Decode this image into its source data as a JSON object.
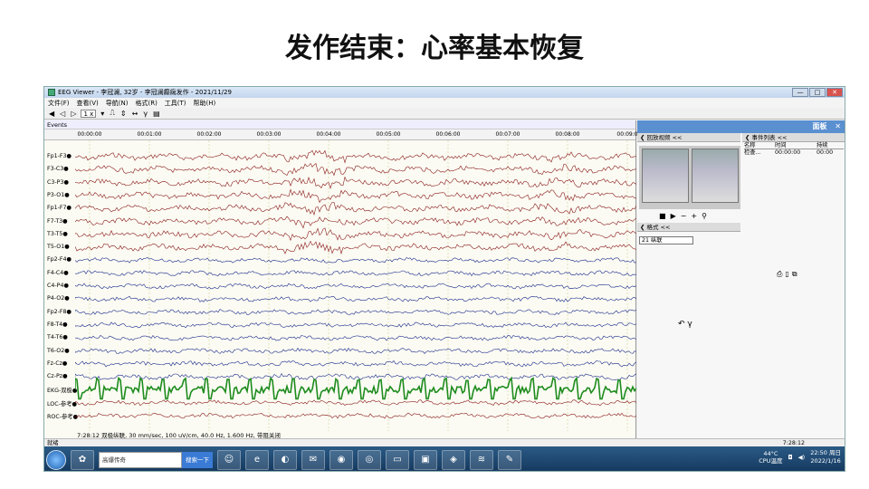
{
  "slide": {
    "title": "发作结束：心率基本恢复"
  },
  "window": {
    "title": "EEG Viewer - 李冠澜, 32岁 - 李冠澜癫痫发作 - 2021/11/29",
    "controls": [
      "—",
      "□",
      "✕"
    ]
  },
  "menu": [
    "文件(F)",
    "查看(V)",
    "导航(N)",
    "格式(R)",
    "工具(T)",
    "帮助(H)"
  ],
  "toolbar": {
    "speed_value": "1 x"
  },
  "eeg": {
    "events_label": "Events",
    "time_labels": [
      "00:00:00",
      "00:01:00",
      "00:02:00",
      "00:03:00",
      "00:04:00",
      "00:05:00",
      "00:06:00",
      "00:07:00",
      "00:08:00",
      "00:09:0"
    ],
    "channels": [
      "Fp1-F3",
      "F3-C3",
      "C3-P3",
      "P3-O1",
      "Fp1-F7",
      "F7-T3",
      "T3-T5",
      "T5-O1",
      "Fp2-F4",
      "F4-C4",
      "C4-P4",
      "P4-O2",
      "Fp2-F8",
      "F8-T4",
      "T4-T6",
      "T6-O2",
      "Fz-Cz",
      "Cz-Pz",
      "EKG-双极",
      "LOC-参考",
      "ROC-参考"
    ],
    "info_text": "7:28:12 双极纵联, 30 mm/sec, 100 uV/cm, 40.0 Hz, 1.600 Hz, 带阻关闭",
    "colors": {
      "red_channels": "#8b1a1a",
      "blue_channels": "#1a2a8b",
      "ekg": "#1e8c1e"
    }
  },
  "panel": {
    "title": "面板",
    "close": "✕",
    "video_section": "回放视频 <<",
    "event_section": "事件列表 <<",
    "format_section": "格式 <<",
    "format_value": "21  纵联",
    "event_headers": [
      "名称",
      "时间",
      "持续"
    ],
    "event_rows": [
      [
        "检查...",
        "00:00:00",
        "00:00"
      ]
    ]
  },
  "status": {
    "left": "就绪",
    "right": "7:28:12"
  },
  "taskbar": {
    "search_text": "高爆传奇",
    "search_button": "搜索一下",
    "temp": "44°C",
    "temp_label": "CPU温度",
    "time": "22:50 周日",
    "date": "2022/1/16"
  }
}
